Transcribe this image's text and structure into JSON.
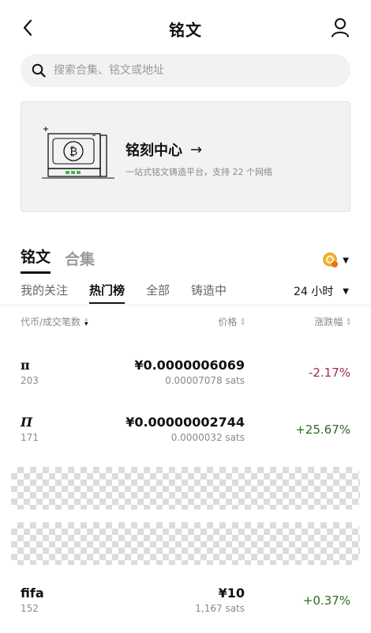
{
  "header": {
    "title": "铭文",
    "back_icon": "chevron-left-icon",
    "user_icon": "user-icon"
  },
  "search": {
    "placeholder": "搜索合集、铭文或地址",
    "value": ""
  },
  "banner": {
    "title": "铭刻中心",
    "arrow": "→",
    "subtitle": "一站式铭文铸造平台，支持 22 个网络"
  },
  "main_tabs": [
    {
      "label": "铭文",
      "active": true
    },
    {
      "label": "合集",
      "active": false
    }
  ],
  "sub_tabs": [
    {
      "label": "我的关注",
      "active": false
    },
    {
      "label": "热门榜",
      "active": true
    },
    {
      "label": "全部",
      "active": false
    },
    {
      "label": "铸造中",
      "active": false
    }
  ],
  "time_filter": {
    "value": "24 小时"
  },
  "columns": {
    "token": "代币/成交笔数",
    "price": "价格",
    "change": "涨跌幅"
  },
  "rows": [
    {
      "name": "π",
      "count": "203",
      "price": "¥0.0000006069",
      "sats": "0.00007078 sats",
      "change": "-2.17%",
      "trend": "neg"
    },
    {
      "name": "Π",
      "count": "171",
      "price": "¥0.00000002744",
      "sats": "0.0000032 sats",
      "change": "+25.67%",
      "trend": "pos"
    },
    {
      "name": "fifa",
      "count": "152",
      "price": "¥10",
      "sats": "1,167 sats",
      "change": "+0.37%",
      "trend": "pos"
    }
  ],
  "colors": {
    "negative": "#9a2c54",
    "positive": "#2e6b1f",
    "accent_orange": "#e89a1a"
  }
}
